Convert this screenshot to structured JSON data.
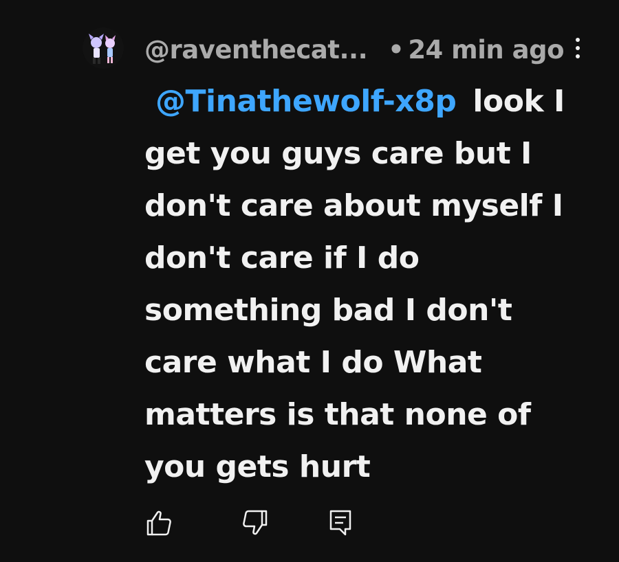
{
  "comment": {
    "author": "@raventhecat...",
    "dot": "•",
    "time": "24 min ago",
    "mention": "@Tinathewolf-x8p",
    "lines": [
      "look I",
      "get you guys care but I",
      "don't care about myself I",
      "don't care if I do",
      "something bad I don't",
      "care what I do What",
      "matters is that none of",
      "you gets hurt"
    ]
  },
  "icons": {
    "avatar": "avatar-image",
    "menu": "more-vertical-icon",
    "like": "thumbs-up-icon",
    "dislike": "thumbs-down-icon",
    "reply": "reply-icon"
  },
  "colors": {
    "background": "#0f0f0f",
    "text": "#f1f1f1",
    "meta": "#aaaaaa",
    "mention": "#3ea6ff"
  }
}
